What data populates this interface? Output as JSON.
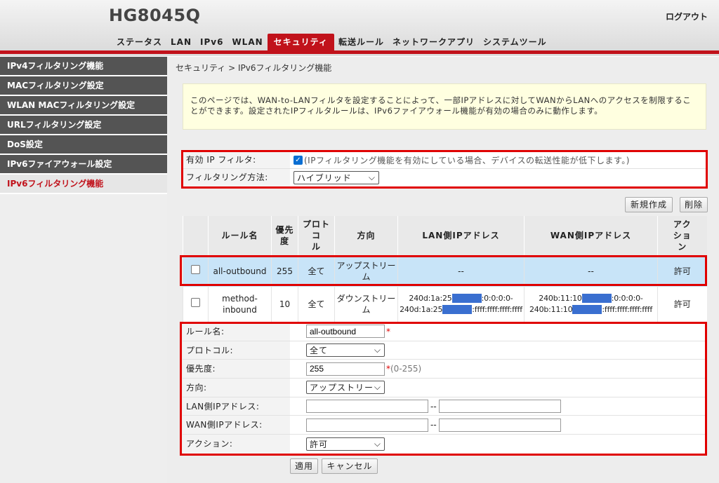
{
  "header": {
    "model": "HG8045Q",
    "logout": "ログアウト",
    "nav": [
      "ステータス",
      "LAN",
      "IPv6",
      "WLAN",
      "セキュリティ",
      "転送ルール",
      "ネットワークアプリ",
      "システムツール"
    ]
  },
  "sidebar": {
    "items": [
      "IPv4フィルタリング機能",
      "MACフィルタリング設定",
      "WLAN MACフィルタリング設定",
      "URLフィルタリング設定",
      "DoS設定",
      "IPv6ファイアウォール設定",
      "IPv6フィルタリング機能"
    ]
  },
  "breadcrumb": "セキュリティ > IPv6フィルタリング機能",
  "info": "このページでは、WAN-to-LANフィルタを設定することによって、一部IPアドレスに対してWANからLANへのアクセスを制限することができます。設定されたIPフィルタルールは、IPv6ファイアウォール機能が有効の場合のみに動作します。",
  "filter": {
    "enable_label": "有効 IP フィルタ:",
    "enable_note": "(IPフィルタリング機能を有効にしている場合、デバイスの転送性能が低下します。)",
    "method_label": "フィルタリング方法:",
    "method_value": "ハイブリッド"
  },
  "buttons": {
    "new": "新規作成",
    "delete": "削除",
    "apply": "適用",
    "cancel": "キャンセル"
  },
  "table": {
    "headers": {
      "name": "ルール名",
      "priority_1": "優先",
      "priority_2": "度",
      "protocol_1": "プロトコ",
      "protocol_2": "ル",
      "direction": "方向",
      "lan": "LAN側IPアドレス",
      "wan": "WAN側IPアドレス",
      "action_1": "アク",
      "action_2": "ショ",
      "action_3": "ン"
    },
    "rows": [
      {
        "name": "all-outbound",
        "priority": "255",
        "protocol": "全て",
        "direction_1": "アップストリー",
        "direction_2": "ム",
        "lan": "--",
        "wan": "--",
        "action": "許可"
      },
      {
        "name_1": "method-",
        "name_2": "inbound",
        "priority": "10",
        "protocol": "全て",
        "direction_1": "ダウンストリー",
        "direction_2": "ム",
        "lan_1a": "240d:1a:25",
        "lan_1b": ":0:0:0:0-",
        "lan_2a": "240d:1a:25",
        "lan_2b": ":ffff:ffff:ffff:ffff",
        "wan_1a": "240b:11:10",
        "wan_1b": ":0:0:0:0-",
        "wan_2a": "240b:11:10",
        "wan_2b": ":ffff:ffff:ffff:ffff",
        "action": "許可"
      }
    ]
  },
  "edit": {
    "name_label": "ルール名:",
    "name_value": "all-outbound",
    "protocol_label": "プロトコル:",
    "protocol_value": "全て",
    "priority_label": "優先度:",
    "priority_value": "255",
    "priority_hint": "(0-255)",
    "direction_label": "方向:",
    "direction_value": "アップストリー",
    "lan_label": "LAN側IPアドレス:",
    "wan_label": "WAN側IPアドレス:",
    "action_label": "アクション:",
    "action_value": "許可",
    "range_sep": "--",
    "required": "*"
  },
  "colors": {
    "accent_red": "#c1121b",
    "highlight_box": "#e00000",
    "selected_row": "#c8e4f8",
    "mask": "#3a6fd0"
  }
}
